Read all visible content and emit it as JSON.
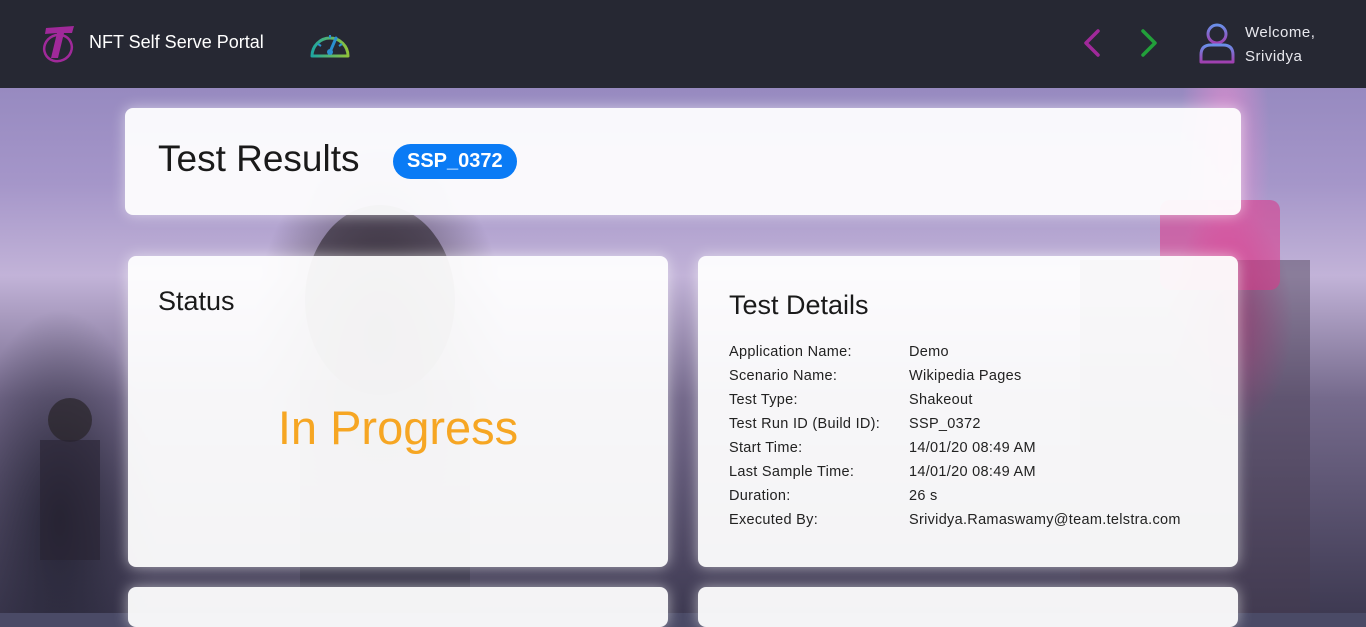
{
  "header": {
    "app_title": "NFT Self Serve Portal",
    "logo_icon": "telstra-logo-icon",
    "dashboard_icon": "speedometer-icon",
    "welcome_line1": "Welcome,",
    "welcome_line2": "Srividya",
    "colors": {
      "bar": "#262833",
      "back_arrow": "#a0299a",
      "forward_arrow": "#22a03a"
    }
  },
  "page": {
    "title": "Test Results",
    "run_badge": "SSP_0372",
    "badge_color": "#0a7bf5"
  },
  "status": {
    "title": "Status",
    "value": "In Progress",
    "value_color": "#f6a623"
  },
  "details": {
    "title": "Test Details",
    "rows": [
      {
        "label": "Application Name:",
        "value": "Demo"
      },
      {
        "label": "Scenario Name:",
        "value": "Wikipedia Pages"
      },
      {
        "label": "Test Type:",
        "value": "Shakeout"
      },
      {
        "label": "Test Run ID (Build ID):",
        "value": "SSP_0372"
      },
      {
        "label": "Start Time:",
        "value": "14/01/20 08:49 AM"
      },
      {
        "label": "Last Sample Time:",
        "value": "14/01/20 08:49 AM"
      },
      {
        "label": "Duration:",
        "value": "26 s"
      },
      {
        "label": "Executed By:",
        "value": "Srividya.Ramaswamy@team.telstra.com"
      }
    ]
  }
}
